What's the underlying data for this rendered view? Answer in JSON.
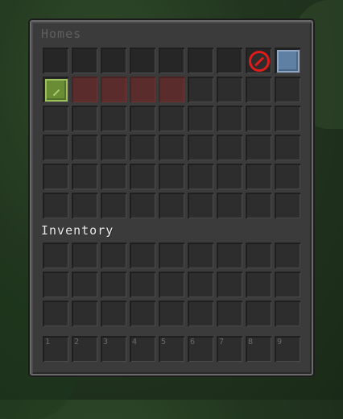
{
  "window": {
    "title": "Homes",
    "inventory_label": "Inventory"
  },
  "homes_grid": {
    "rows": 6,
    "cols": 9,
    "special_slots": [
      {
        "row": 0,
        "col": 7,
        "icon": "barrier-no-entry-icon"
      },
      {
        "row": 0,
        "col": 8,
        "icon": "blue-glass-pane-icon"
      },
      {
        "row": 1,
        "col": 0,
        "icon": "green-glass-pane-icon"
      }
    ],
    "red_slots": [
      {
        "row": 1,
        "col": 1
      },
      {
        "row": 1,
        "col": 2
      },
      {
        "row": 1,
        "col": 3
      },
      {
        "row": 1,
        "col": 4
      }
    ]
  },
  "inventory_grid": {
    "rows": 3,
    "cols": 9
  },
  "hotbar": {
    "slot_numbers": [
      "1",
      "2",
      "3",
      "4",
      "5",
      "6",
      "7",
      "8",
      "9"
    ]
  },
  "colors": {
    "barrier_red": "#e01b1b",
    "blue_pane": "#5f7fa3",
    "green_pane": "#6a8c35",
    "red_slot": "#5a2c2c"
  }
}
